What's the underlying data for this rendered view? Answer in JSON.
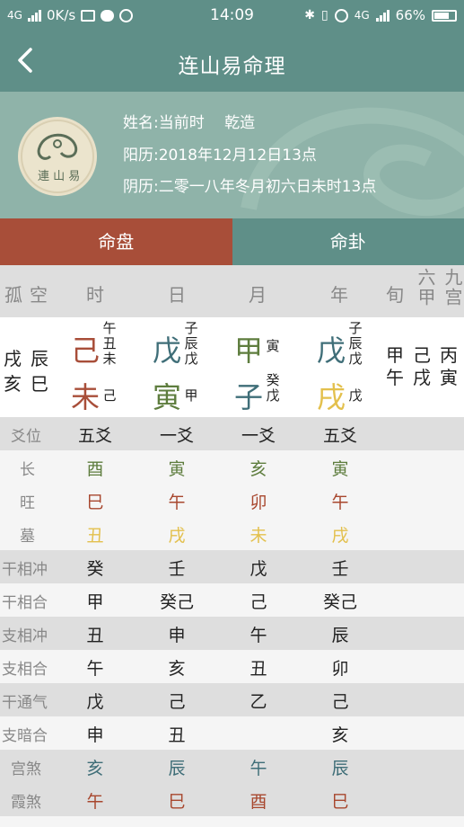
{
  "status_bar": {
    "network": "4G",
    "speed": "0K/s",
    "time": "14:09",
    "network2": "4G",
    "battery": "66%"
  },
  "header": {
    "title": "连山易命理"
  },
  "info": {
    "name_line": "姓名:当前时　 乾造",
    "solar_line": "阳历:2018年12月12日13点",
    "lunar_line": "阴历:二零一八年冬月初六日未时13点"
  },
  "tabs": [
    {
      "label": "命盘",
      "active": true
    },
    {
      "label": "命卦",
      "active": false
    }
  ],
  "colors": {
    "teal": "#5f8f88",
    "red": "#a84e39",
    "green": "#5e7d3e",
    "blue": "#3f6e78",
    "yellow": "#e3c04d",
    "brown": "#a8472e"
  },
  "columns": {
    "gu": "孤",
    "kong": "空",
    "shi": "时",
    "ri": "日",
    "yue": "月",
    "nian": "年",
    "xun": "旬",
    "liujia": "六甲",
    "jiugong": "九宫"
  },
  "pillars": {
    "left_top": [
      "戌",
      "辰"
    ],
    "left_bottom": [
      "亥",
      "巳"
    ],
    "shi": {
      "stem": "己",
      "branch": "未",
      "hidden_top": [
        "午",
        "丑",
        "未"
      ],
      "hidden_bottom": "己"
    },
    "ri": {
      "stem": "戊",
      "branch": "寅",
      "hidden_top": [
        "子",
        "辰",
        "戊"
      ],
      "hidden_bottom": "甲"
    },
    "yue": {
      "stem": "甲",
      "branch": "子",
      "hidden_top": [
        "寅"
      ],
      "hidden_bottom": [
        "癸",
        "戊"
      ]
    },
    "nian": {
      "stem": "戊",
      "branch": "戌",
      "hidden_top": [
        "子",
        "辰",
        "戊"
      ],
      "hidden_bottom": "戊"
    },
    "xun": [
      "甲",
      "午"
    ],
    "liujia": [
      "己",
      "戌"
    ],
    "jiugong": [
      "丙",
      "寅"
    ]
  },
  "rows": [
    {
      "label": "爻位",
      "values": [
        "五爻",
        "一爻",
        "一爻",
        "五爻"
      ],
      "colors": [
        "#222",
        "#222",
        "#222",
        "#222"
      ]
    },
    {
      "label": "长",
      "values": [
        "酉",
        "寅",
        "亥",
        "寅"
      ],
      "colors": [
        "#5e7d3e",
        "#5e7d3e",
        "#5e7d3e",
        "#5e7d3e"
      ]
    },
    {
      "label": "旺",
      "values": [
        "巳",
        "午",
        "卯",
        "午"
      ],
      "colors": [
        "#a8472e",
        "#a8472e",
        "#a8472e",
        "#a8472e"
      ]
    },
    {
      "label": "墓",
      "values": [
        "丑",
        "戌",
        "未",
        "戌"
      ],
      "colors": [
        "#e3c04d",
        "#e3c04d",
        "#e3c04d",
        "#e3c04d"
      ]
    },
    {
      "label": "干相冲",
      "values": [
        "癸",
        "壬",
        "戊",
        "壬"
      ],
      "colors": [
        "#222",
        "#222",
        "#222",
        "#222"
      ]
    },
    {
      "label": "干相合",
      "values": [
        "甲",
        "癸己",
        "己",
        "癸己"
      ],
      "colors": [
        "#222",
        "#222",
        "#222",
        "#222"
      ]
    },
    {
      "label": "支相冲",
      "values": [
        "丑",
        "申",
        "午",
        "辰"
      ],
      "colors": [
        "#222",
        "#222",
        "#222",
        "#222"
      ]
    },
    {
      "label": "支相合",
      "values": [
        "午",
        "亥",
        "丑",
        "卯"
      ],
      "colors": [
        "#222",
        "#222",
        "#222",
        "#222"
      ]
    },
    {
      "label": "干通气",
      "values": [
        "戊",
        "己",
        "乙",
        "己"
      ],
      "colors": [
        "#222",
        "#222",
        "#222",
        "#222"
      ]
    },
    {
      "label": "支暗合",
      "values": [
        "申",
        "丑",
        "",
        "亥"
      ],
      "colors": [
        "#222",
        "#222",
        "#222",
        "#222"
      ]
    },
    {
      "label": "宫煞",
      "values": [
        "亥",
        "辰",
        "午",
        "辰"
      ],
      "colors": [
        "#3f6e78",
        "#3f6e78",
        "#3f6e78",
        "#3f6e78"
      ]
    },
    {
      "label": "霞煞",
      "values": [
        "午",
        "巳",
        "酉",
        "巳"
      ],
      "colors": [
        "#a8472e",
        "#a8472e",
        "#a8472e",
        "#a8472e"
      ]
    }
  ]
}
